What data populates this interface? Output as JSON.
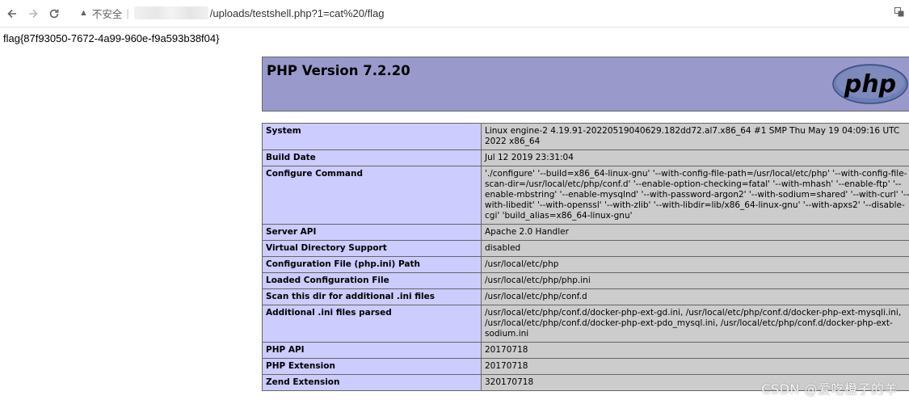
{
  "browser": {
    "security_text": "不安全",
    "separator": "|",
    "url_path": "/uploads/testshell.php?1=cat%20/flag",
    "icons": [
      "back-arrow-icon",
      "forward-arrow-icon",
      "reload-icon",
      "warning-icon",
      "translate-icon"
    ]
  },
  "page": {
    "flag": "flag{87f93050-7672-4a99-960e-f9a593b38f04}"
  },
  "phpinfo": {
    "version": "PHP Version 7.2.20",
    "logo_text": "php",
    "colors": {
      "header": "#9999cc",
      "label_cell": "#ccccff",
      "value_cell": "#cccccc"
    },
    "rows": [
      {
        "label": "System",
        "value": "Linux engine-2 4.19.91-20220519040629.182dd72.al7.x86_64 #1 SMP Thu May 19 04:09:16 UTC 2022 x86_64"
      },
      {
        "label": "Build Date",
        "value": "Jul 12 2019 23:31:04"
      },
      {
        "label": "Configure Command",
        "value": "'./configure' '--build=x86_64-linux-gnu' '--with-config-file-path=/usr/local/etc/php' '--with-config-file-scan-dir=/usr/local/etc/php/conf.d' '--enable-option-checking=fatal' '--with-mhash' '--enable-ftp' '--enable-mbstring' '--enable-mysqlnd' '--with-password-argon2' '--with-sodium=shared' '--with-curl' '--with-libedit' '--with-openssl' '--with-zlib' '--with-libdir=lib/x86_64-linux-gnu' '--with-apxs2' '--disable-cgi' 'build_alias=x86_64-linux-gnu'"
      },
      {
        "label": "Server API",
        "value": "Apache 2.0 Handler"
      },
      {
        "label": "Virtual Directory Support",
        "value": "disabled"
      },
      {
        "label": "Configuration File (php.ini) Path",
        "value": "/usr/local/etc/php"
      },
      {
        "label": "Loaded Configuration File",
        "value": "/usr/local/etc/php/php.ini"
      },
      {
        "label": "Scan this dir for additional .ini files",
        "value": "/usr/local/etc/php/conf.d"
      },
      {
        "label": "Additional .ini files parsed",
        "value": "/usr/local/etc/php/conf.d/docker-php-ext-gd.ini, /usr/local/etc/php/conf.d/docker-php-ext-mysqli.ini, /usr/local/etc/php/conf.d/docker-php-ext-pdo_mysql.ini, /usr/local/etc/php/conf.d/docker-php-ext-sodium.ini"
      },
      {
        "label": "PHP API",
        "value": "20170718"
      },
      {
        "label": "PHP Extension",
        "value": "20170718"
      },
      {
        "label": "Zend Extension",
        "value": "320170718"
      }
    ]
  },
  "watermark": "CSDN @爱吃橙子的羊"
}
